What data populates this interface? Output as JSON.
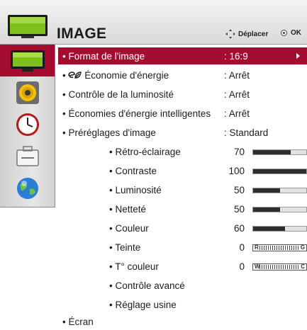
{
  "header": {
    "title": "IMAGE",
    "move_hint": "Déplacer",
    "ok_hint": "OK"
  },
  "categories": [
    {
      "icon": "tv-picture-icon",
      "active": true
    },
    {
      "icon": "speaker-audio-icon",
      "active": false
    },
    {
      "icon": "clock-time-icon",
      "active": false
    },
    {
      "icon": "toolbox-option-icon",
      "active": false
    },
    {
      "icon": "globe-network-icon",
      "active": false
    }
  ],
  "menu": {
    "format": {
      "label": "• Format de l'image",
      "value": ": 16:9"
    },
    "energy": {
      "prefix": "• ",
      "label": " Économie d'énergie",
      "value": ": Arrêt"
    },
    "brightness_control": {
      "label": "• Contrôle de la luminosité",
      "value": ": Arrêt"
    },
    "smart_energy": {
      "label": "• Économies d'énergie intelligentes",
      "value": ": Arrêt"
    },
    "presets": {
      "label": "• Préréglages d'image",
      "value": ": Standard"
    },
    "backlight": {
      "label": "• Rétro-éclairage",
      "value": "70",
      "level": 0.7
    },
    "contrast": {
      "label": "• Contraste",
      "value": "100",
      "level": 1.0
    },
    "luminosity": {
      "label": "• Luminosité",
      "value": "50",
      "level": 0.5
    },
    "sharpness": {
      "label": "• Netteté",
      "value": "50",
      "level": 0.5
    },
    "color": {
      "label": "• Couleur",
      "value": "60",
      "level": 0.6
    },
    "tint": {
      "label": "• Teinte",
      "value": "0",
      "left_end": "R",
      "right_end": "G"
    },
    "color_temp": {
      "label": "• T° couleur",
      "value": "0",
      "left_end": "W",
      "right_end": "C"
    },
    "advanced": {
      "label": "• Contrôle avancé"
    },
    "reset": {
      "label": "• Réglage usine"
    },
    "screen": {
      "label": "• Écran"
    }
  },
  "colors": {
    "accent": "#a30b30",
    "bar_fill": "#2f2f2f"
  }
}
